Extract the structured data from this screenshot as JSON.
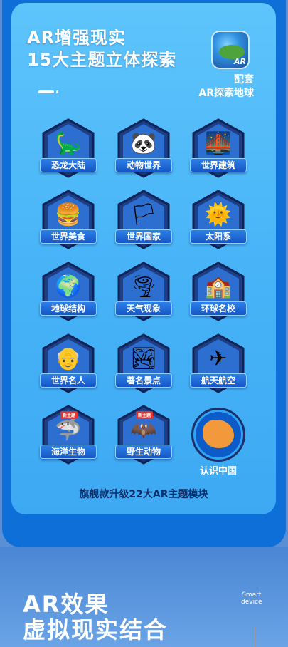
{
  "header": {
    "line1": "AR增强现实",
    "line2": "15大主题立体探索",
    "companion_line1": "配套",
    "companion_line2": "AR探索地球",
    "app_icon_label": "AR"
  },
  "themes": [
    {
      "label": "恐龙大陆",
      "icon": "dinosaur-icon",
      "glyph": "🦕"
    },
    {
      "label": "动物世界",
      "icon": "panda-icon",
      "glyph": "🐼"
    },
    {
      "label": "世界建筑",
      "icon": "bridge-icon",
      "glyph": "🌉"
    },
    {
      "label": "世界美食",
      "icon": "food-icon",
      "glyph": "🍔"
    },
    {
      "label": "世界国家",
      "icon": "flags-icon",
      "glyph": "🏳"
    },
    {
      "label": "太阳系",
      "icon": "sun-icon",
      "glyph": "🌞"
    },
    {
      "label": "地球结构",
      "icon": "earth-layers-icon",
      "glyph": "🌍"
    },
    {
      "label": "天气现象",
      "icon": "tornado-icon",
      "glyph": "🌪"
    },
    {
      "label": "环球名校",
      "icon": "school-icon",
      "glyph": "🏫"
    },
    {
      "label": "世界名人",
      "icon": "einstein-icon",
      "glyph": "👴"
    },
    {
      "label": "著名景点",
      "icon": "landscape-icon",
      "glyph": "🏞"
    },
    {
      "label": "航天航空",
      "icon": "airplane-icon",
      "glyph": "✈"
    },
    {
      "label": "海洋生物",
      "icon": "shark-icon",
      "glyph": "🦈",
      "badge": "新主题"
    },
    {
      "label": "野生动物",
      "icon": "bat-icon",
      "glyph": "🦇",
      "badge": "新主题"
    }
  ],
  "china": {
    "label": "认识中国",
    "icon": "china-map-icon"
  },
  "caption": "旗舰款升级22大AR主题模块",
  "section": {
    "title_line1": "AR效果",
    "title_line2": "虚拟现实结合",
    "side_line1": "Smart",
    "side_line2": "device"
  },
  "colors": {
    "card": "#46b3f7",
    "outer": "#0e6fd8",
    "label_bg": "#1557c6",
    "badge": "#e3332b"
  }
}
